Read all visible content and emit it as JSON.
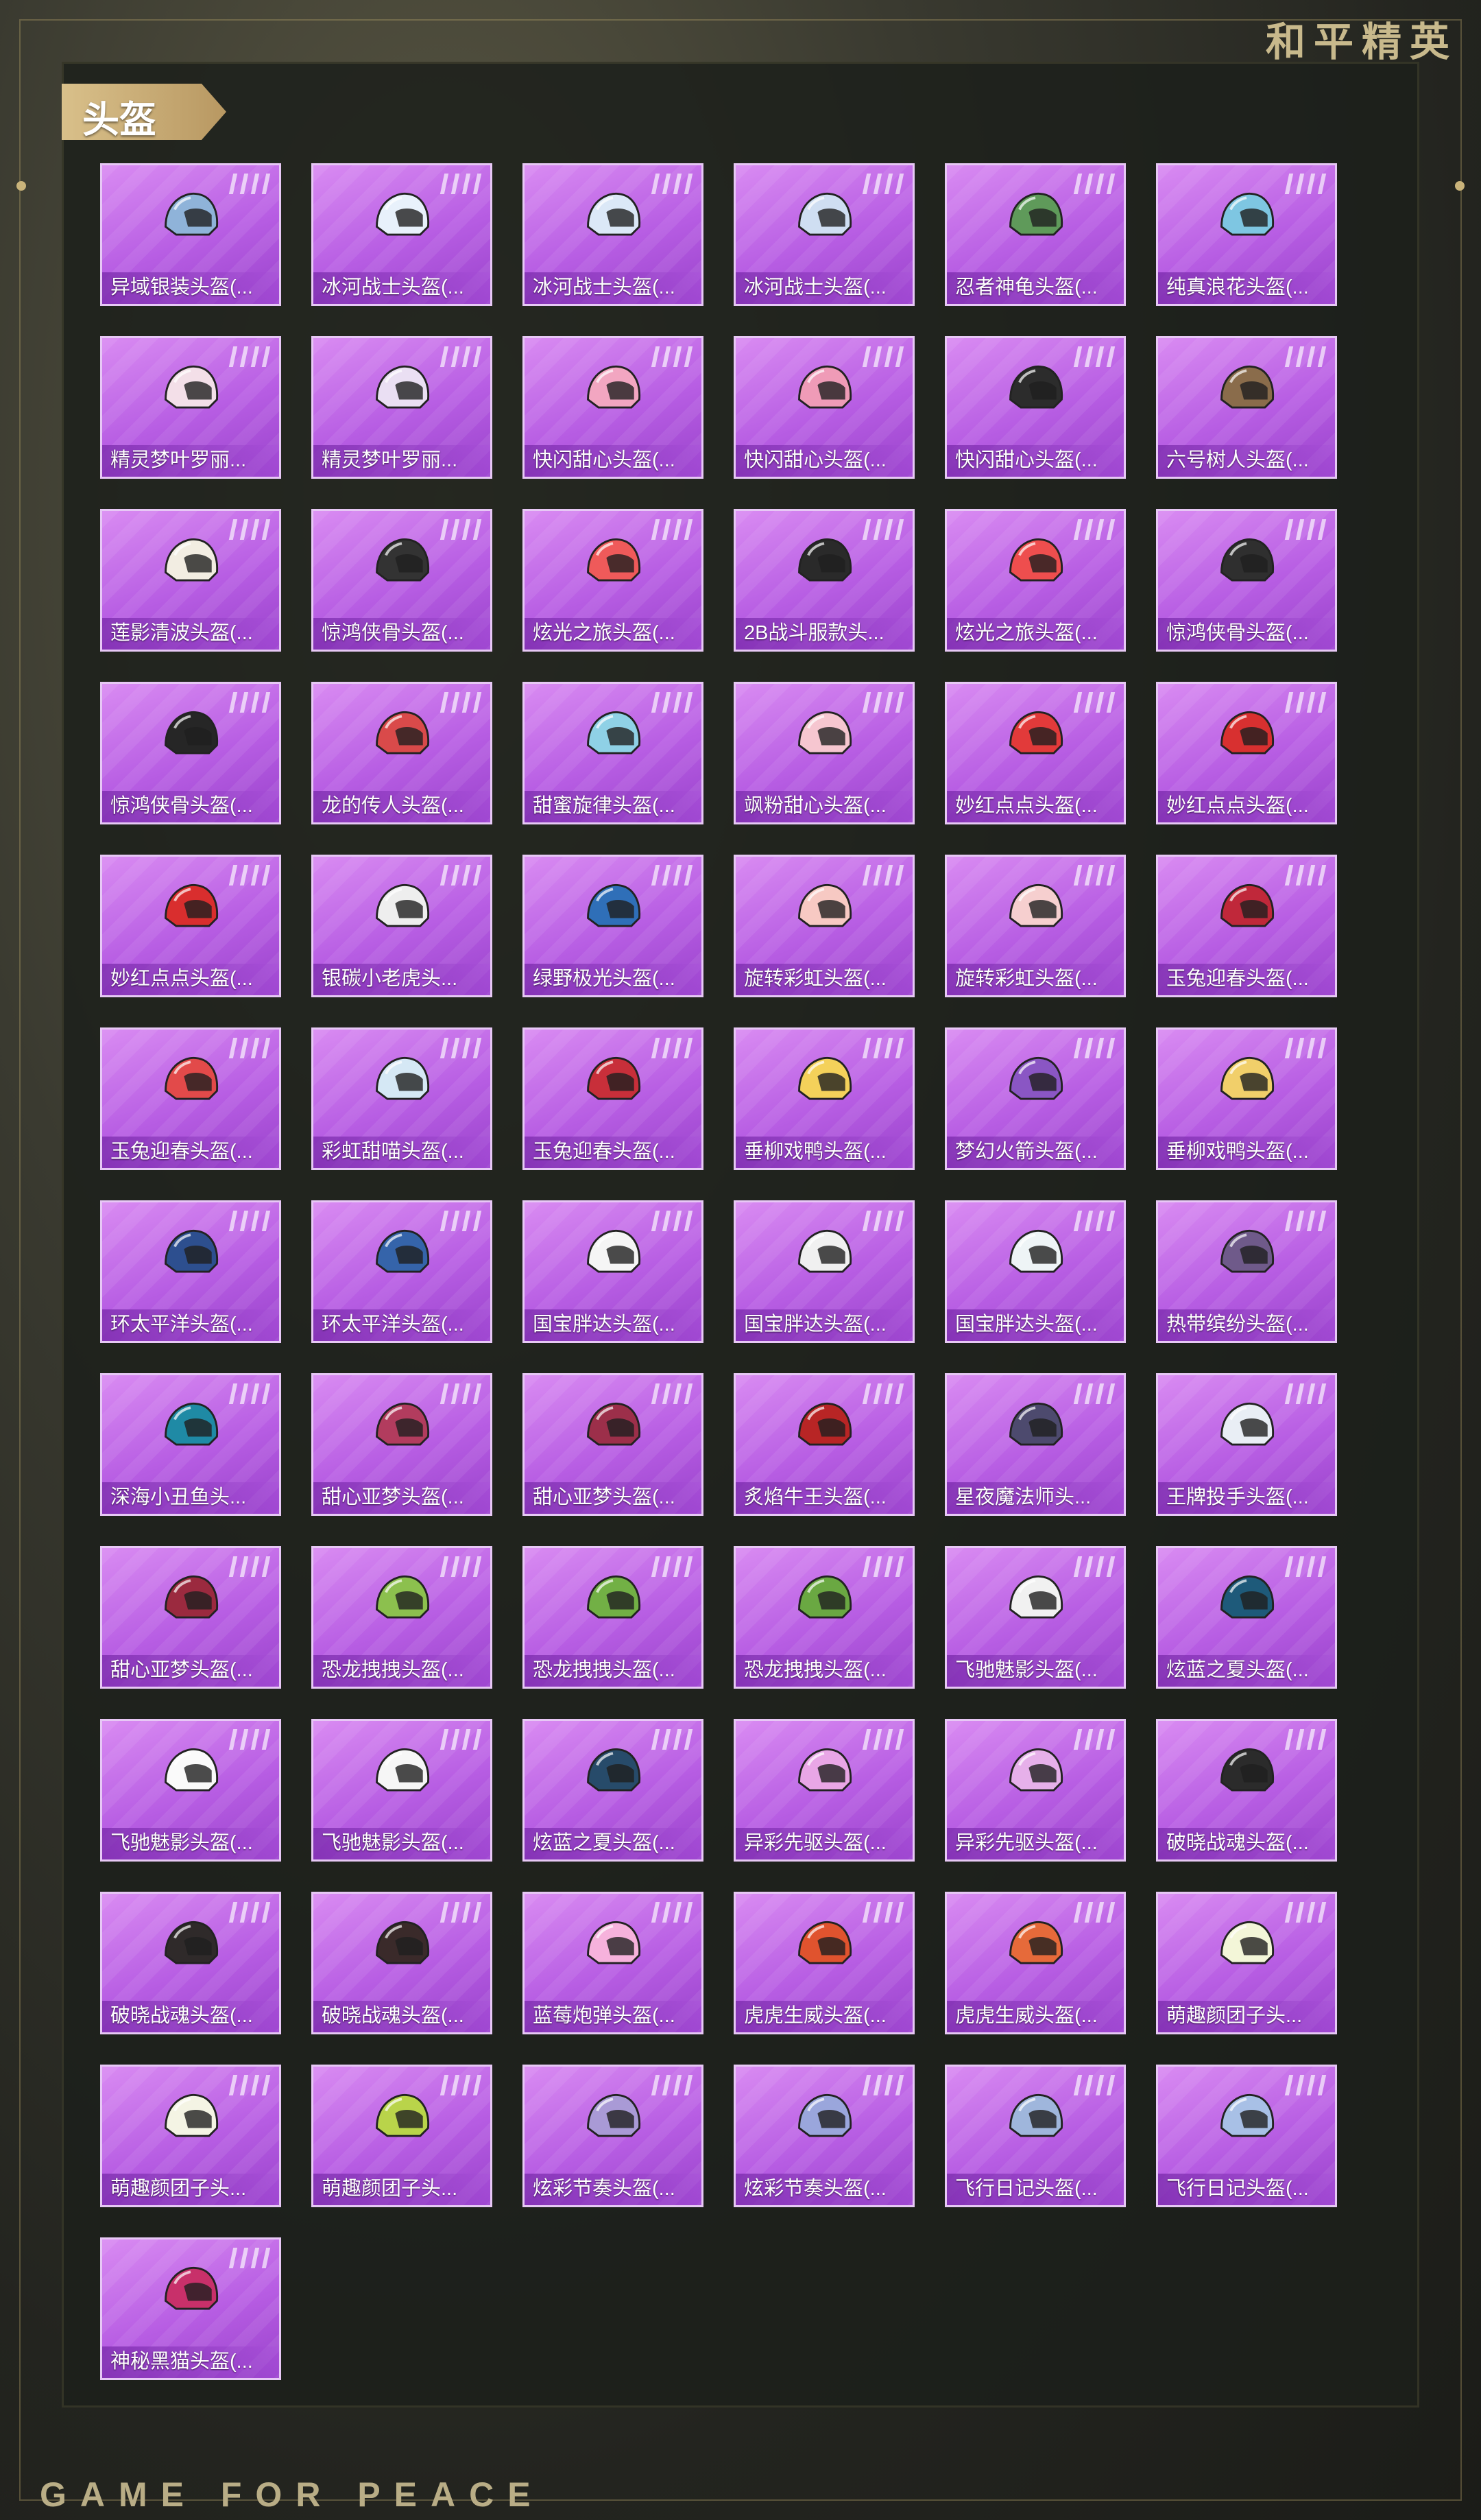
{
  "brand": {
    "cn": "和平精英",
    "en": "GAME FOR PEACE"
  },
  "section": {
    "title": "头盔"
  },
  "items": [
    {
      "name": "异域银装头盔(...",
      "color": "#8fb3d9"
    },
    {
      "name": "冰河战士头盔(...",
      "color": "#e8f1fb"
    },
    {
      "name": "冰河战士头盔(...",
      "color": "#dbe8f7"
    },
    {
      "name": "冰河战士头盔(...",
      "color": "#cfdef2"
    },
    {
      "name": "忍者神龟头盔(...",
      "color": "#5f9a5a"
    },
    {
      "name": "纯真浪花头盔(...",
      "color": "#7ec6e2"
    },
    {
      "name": "精灵梦叶罗丽...",
      "color": "#f3dfe8"
    },
    {
      "name": "精灵梦叶罗丽...",
      "color": "#eadff3"
    },
    {
      "name": "快闪甜心头盔(...",
      "color": "#f2a6c1"
    },
    {
      "name": "快闪甜心头盔(...",
      "color": "#ef9bb7"
    },
    {
      "name": "快闪甜心头盔(...",
      "color": "#2c2c2c"
    },
    {
      "name": "六号树人头盔(...",
      "color": "#8a6c4b"
    },
    {
      "name": "莲影清波头盔(...",
      "color": "#f2ede2"
    },
    {
      "name": "惊鸿侠骨头盔(...",
      "color": "#333333"
    },
    {
      "name": "炫光之旅头盔(...",
      "color": "#ef5a5a"
    },
    {
      "name": "2B战斗服款头...",
      "color": "#2a2a2a"
    },
    {
      "name": "炫光之旅头盔(...",
      "color": "#ee4e4e"
    },
    {
      "name": "惊鸿侠骨头盔(...",
      "color": "#2f2f2f"
    },
    {
      "name": "惊鸿侠骨头盔(...",
      "color": "#262626"
    },
    {
      "name": "龙的传人头盔(...",
      "color": "#d94a4a"
    },
    {
      "name": "甜蜜旋律头盔(...",
      "color": "#8fd1e6"
    },
    {
      "name": "飒粉甜心头盔(...",
      "color": "#f6c6d0"
    },
    {
      "name": "妙红点点头盔(...",
      "color": "#e23a3a"
    },
    {
      "name": "妙红点点头盔(...",
      "color": "#d83030"
    },
    {
      "name": "妙红点点头盔(...",
      "color": "#d92e2e"
    },
    {
      "name": "银碳小老虎头...",
      "color": "#eeeeee"
    },
    {
      "name": "绿野极光头盔(...",
      "color": "#2f6fb8"
    },
    {
      "name": "旋转彩虹头盔(...",
      "color": "#f7c9c3"
    },
    {
      "name": "旋转彩虹头盔(...",
      "color": "#f6cfcf"
    },
    {
      "name": "玉兔迎春头盔(...",
      "color": "#c0283a"
    },
    {
      "name": "玉兔迎春头盔(...",
      "color": "#e24a4a"
    },
    {
      "name": "彩虹甜喵头盔(...",
      "color": "#d5e8f5"
    },
    {
      "name": "玉兔迎春头盔(...",
      "color": "#c82f3a"
    },
    {
      "name": "垂柳戏鸭头盔(...",
      "color": "#f4d15a"
    },
    {
      "name": "梦幻火箭头盔(...",
      "color": "#8a56c4"
    },
    {
      "name": "垂柳戏鸭头盔(...",
      "color": "#f1cf6a"
    },
    {
      "name": "环太平洋头盔(...",
      "color": "#2d4f8f"
    },
    {
      "name": "环太平洋头盔(...",
      "color": "#3564aa"
    },
    {
      "name": "国宝胖达头盔(...",
      "color": "#f5f5f5"
    },
    {
      "name": "国宝胖达头盔(...",
      "color": "#f0f0f0"
    },
    {
      "name": "国宝胖达头盔(...",
      "color": "#eef4f6"
    },
    {
      "name": "热带缤纷头盔(...",
      "color": "#6f5a8a"
    },
    {
      "name": "深海小丑鱼头...",
      "color": "#1f8aa5"
    },
    {
      "name": "甜心亚梦头盔(...",
      "color": "#b23c5e"
    },
    {
      "name": "甜心亚梦头盔(...",
      "color": "#9c2f4a"
    },
    {
      "name": "炙焰牛王头盔(...",
      "color": "#b82525"
    },
    {
      "name": "星夜魔法师头...",
      "color": "#4d4a6e"
    },
    {
      "name": "王牌投手头盔(...",
      "color": "#e9eef5"
    },
    {
      "name": "甜心亚梦头盔(...",
      "color": "#9b2a3f"
    },
    {
      "name": "恐龙拽拽头盔(...",
      "color": "#8cc04e"
    },
    {
      "name": "恐龙拽拽头盔(...",
      "color": "#72b045"
    },
    {
      "name": "恐龙拽拽头盔(...",
      "color": "#6aa842"
    },
    {
      "name": "飞驰魅影头盔(...",
      "color": "#f1f1f1"
    },
    {
      "name": "炫蓝之夏头盔(...",
      "color": "#1e5a7a"
    },
    {
      "name": "飞驰魅影头盔(...",
      "color": "#fafafa"
    },
    {
      "name": "飞驰魅影头盔(...",
      "color": "#f6f6f6"
    },
    {
      "name": "炫蓝之夏头盔(...",
      "color": "#274b6a"
    },
    {
      "name": "异彩先驱头盔(...",
      "color": "#e9a6e6"
    },
    {
      "name": "异彩先驱头盔(...",
      "color": "#e6b0ea"
    },
    {
      "name": "破晓战魂头盔(...",
      "color": "#2b2b2b"
    },
    {
      "name": "破晓战魂头盔(...",
      "color": "#2f2a2a"
    },
    {
      "name": "破晓战魂头盔(...",
      "color": "#3a2a2a"
    },
    {
      "name": "蓝莓炮弹头盔(...",
      "color": "#f6b2dc"
    },
    {
      "name": "虎虎生威头盔(...",
      "color": "#e0532e"
    },
    {
      "name": "虎虎生威头盔(...",
      "color": "#e66a3a"
    },
    {
      "name": "萌趣颜团子头...",
      "color": "#f3f6d8"
    },
    {
      "name": "萌趣颜团子头...",
      "color": "#f4f4e4"
    },
    {
      "name": "萌趣颜团子头...",
      "color": "#b9d44a"
    },
    {
      "name": "炫彩节奏头盔(...",
      "color": "#a99ad6"
    },
    {
      "name": "炫彩节奏头盔(...",
      "color": "#9aa6dc"
    },
    {
      "name": "飞行日记头盔(...",
      "color": "#9fb6dc"
    },
    {
      "name": "飞行日记头盔(...",
      "color": "#a8c0e6"
    },
    {
      "name": "神秘黑猫头盔(...",
      "color": "#c8306a"
    }
  ]
}
